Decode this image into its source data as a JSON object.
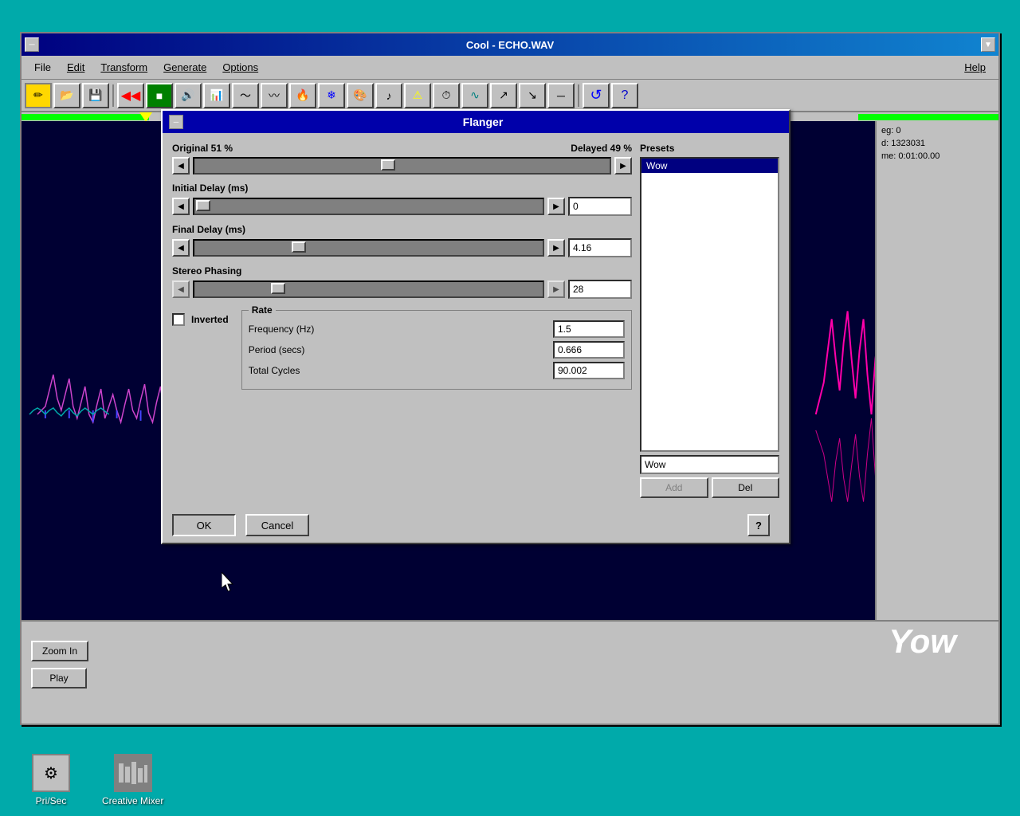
{
  "app": {
    "title": "Cool - ECHO.WAV",
    "minimize_label": "−",
    "maximize_label": "▼"
  },
  "menu": {
    "items": [
      "File",
      "Edit",
      "Transform",
      "Generate",
      "Options",
      "Help"
    ]
  },
  "toolbar": {
    "buttons": [
      "✏️",
      "📁",
      "💾",
      "⏮",
      "▬",
      "🔊",
      "📊",
      "🎵",
      "〰",
      "🔥",
      "❄",
      "🎨",
      "🎹",
      "⏱",
      "🌊",
      "📈",
      "📉",
      "🔄",
      "❓"
    ]
  },
  "flanger": {
    "title": "Flanger",
    "original_label": "Original 51 %",
    "delayed_label": "Delayed 49 %",
    "initial_delay_label": "Initial Delay (ms)",
    "initial_delay_value": "0",
    "final_delay_label": "Final Delay (ms)",
    "final_delay_value": "4.16",
    "stereo_phasing_label": "Stereo Phasing",
    "stereo_phasing_value": "28",
    "inverted_label": "Inverted",
    "rate_group_label": "Rate",
    "frequency_label": "Frequency (Hz)",
    "frequency_value": "1.5",
    "period_label": "Period (secs)",
    "period_value": "0.666",
    "total_cycles_label": "Total Cycles",
    "total_cycles_value": "90.002",
    "ok_label": "OK",
    "cancel_label": "Cancel",
    "help_label": "?"
  },
  "presets": {
    "label": "Presets",
    "items": [
      "Wow"
    ],
    "selected": "Wow",
    "name_input": "Wow",
    "add_label": "Add",
    "del_label": "Del"
  },
  "status": {
    "beg": "eg: 0",
    "id": "d: 1323031",
    "time": "me: 0:01:00.00"
  },
  "bottom_controls": {
    "zoom_in": "Zoom In",
    "play": "Play"
  },
  "taskbar": {
    "items": [
      {
        "label": "Pri/Sec",
        "icon": "⚙"
      },
      {
        "label": "Creative Mixer",
        "icon": "🎛"
      }
    ]
  },
  "yow_text": "Yow"
}
